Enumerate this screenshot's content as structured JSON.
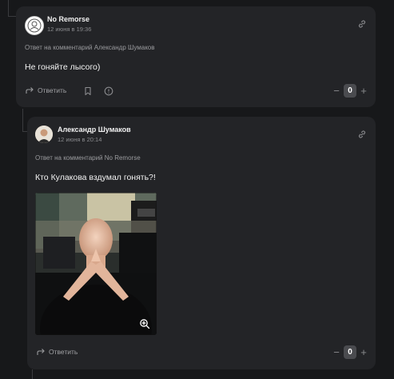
{
  "comments": [
    {
      "author": "No Remorse",
      "date": "12 июня в 19:36",
      "reply_to": "Ответ на комментарий Александр Шумаков",
      "text": "Не гоняйте лысого)",
      "reply_label": "Ответить",
      "score": "0"
    },
    {
      "author": "Александр Шумаков",
      "date": "12 июня в 20:14",
      "reply_to": "Ответ на комментарий No Remorse",
      "text": "Кто Кулакова вздумал гонять?!",
      "reply_label": "Ответить",
      "score": "0"
    }
  ],
  "vote": {
    "minus": "−",
    "plus": "+"
  },
  "colors": {
    "background": "#17181a",
    "card": "#232427",
    "score_bg": "#4a4b4f"
  },
  "icons": [
    "link-icon",
    "reply-arrow-icon",
    "bookmark-icon",
    "info-icon",
    "zoom-icon"
  ]
}
